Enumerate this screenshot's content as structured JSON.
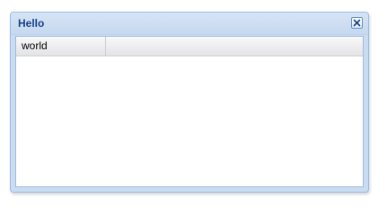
{
  "window": {
    "title": "Hello"
  },
  "grid": {
    "columns": [
      {
        "label": "world"
      },
      {
        "label": ""
      }
    ]
  },
  "icons": {
    "close": "close-icon"
  },
  "colors": {
    "title_text": "#15428b",
    "window_border": "#99bbe8",
    "titlebar_bg": "#cbdcf0"
  }
}
